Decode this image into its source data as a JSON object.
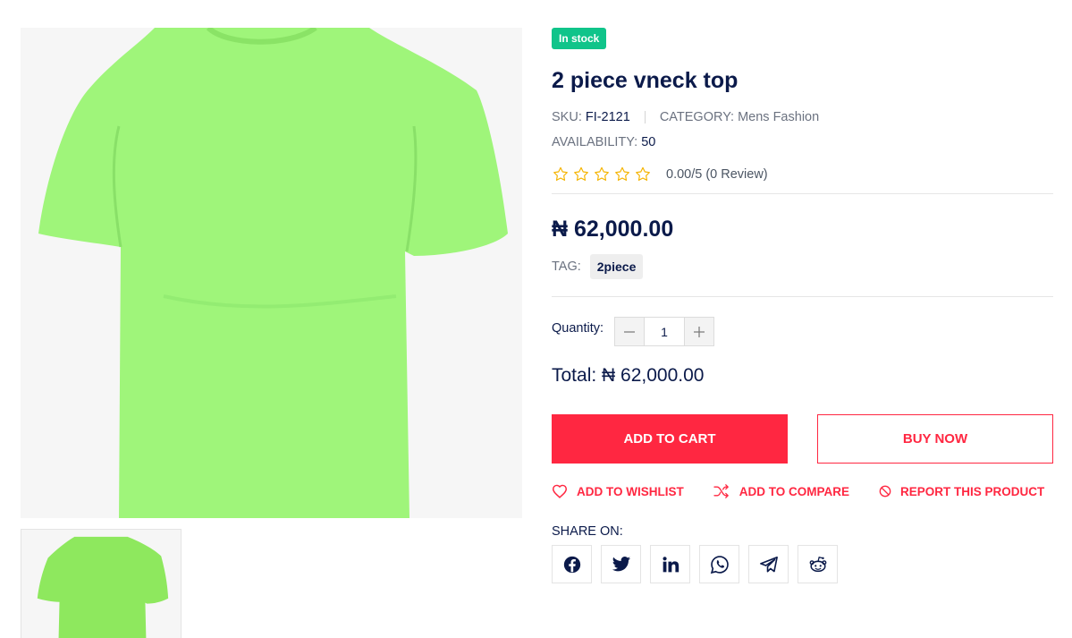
{
  "product": {
    "stock_badge": "In stock",
    "title": "2 piece vneck top",
    "sku_label": "SKU:",
    "sku": "FI-2121",
    "category_label": "CATEGORY:",
    "category": "Mens Fashion",
    "availability_label": "AVAILABILITY:",
    "availability": "50",
    "rating": 0,
    "rating_max": 5,
    "rating_text": "0.00/5 (0 Review)",
    "price": "₦ 62,000.00",
    "tag_label": "TAG:",
    "tag": "2piece",
    "image_color": "#a0f57c"
  },
  "purchase": {
    "quantity_label": "Quantity:",
    "quantity": "1",
    "decrement_icon": "minus-icon",
    "increment_icon": "plus-icon",
    "total": "Total: ₦ 62,000.00",
    "add_to_cart": "ADD TO CART",
    "buy_now": "BUY NOW"
  },
  "actions": {
    "wishlist": "ADD TO WISHLIST",
    "compare": "ADD TO COMPARE",
    "report": "REPORT THIS PRODUCT"
  },
  "share": {
    "label": "SHARE ON:",
    "networks": [
      "facebook-icon",
      "twitter-icon",
      "linkedin-icon",
      "whatsapp-icon",
      "telegram-icon",
      "reddit-icon"
    ]
  },
  "colors": {
    "accent": "#ff2741",
    "stock": "#10c48a",
    "navy": "#0b1a4a",
    "star": "#f5b400"
  }
}
